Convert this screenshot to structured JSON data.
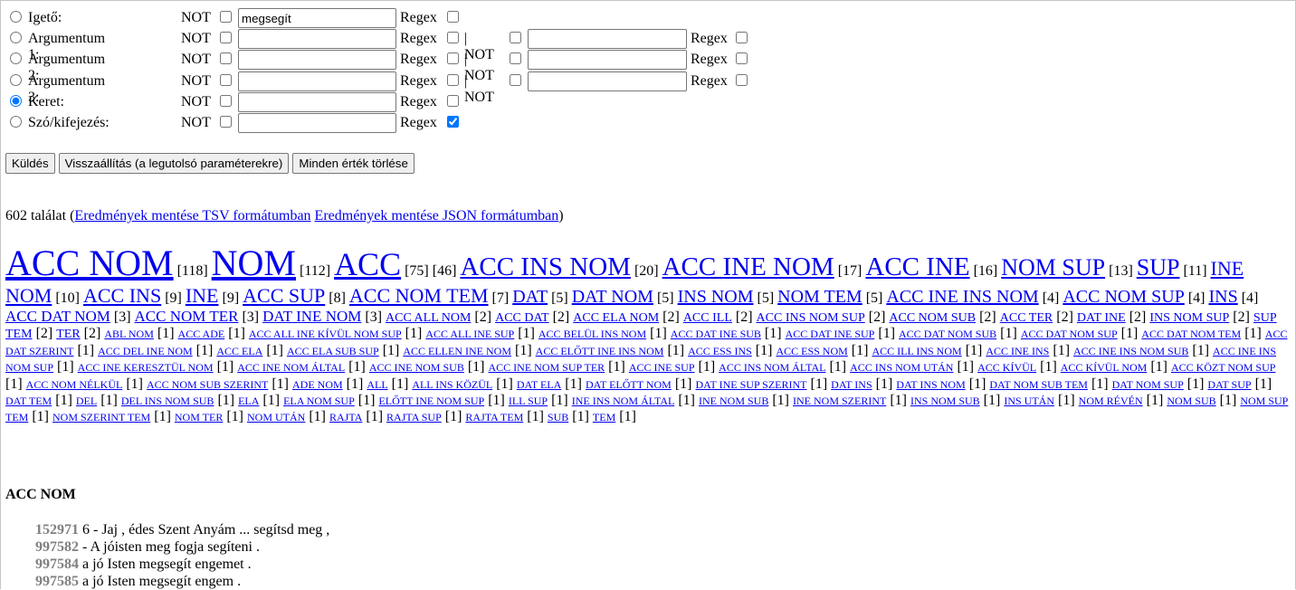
{
  "form": {
    "rows": [
      {
        "label": "Igető:",
        "not": "NOT",
        "regex": "Regex",
        "value": "megsegít",
        "checked": false,
        "regex_checked": false,
        "has_second": false
      },
      {
        "label": "Argumentum 1:",
        "not": "NOT",
        "regex": "Regex",
        "value": "",
        "checked": false,
        "regex_checked": false,
        "has_second": true,
        "sep": "| NOT",
        "regex2": "Regex"
      },
      {
        "label": "Argumentum 2:",
        "not": "NOT",
        "regex": "Regex",
        "value": "",
        "checked": false,
        "regex_checked": false,
        "has_second": true,
        "sep": "| NOT",
        "regex2": "Regex"
      },
      {
        "label": "Argumentum 3:",
        "not": "NOT",
        "regex": "Regex",
        "value": "",
        "checked": false,
        "regex_checked": false,
        "has_second": true,
        "sep": "| NOT",
        "regex2": "Regex"
      },
      {
        "label": "Keret:",
        "not": "NOT",
        "regex": "Regex",
        "value": "",
        "checked": true,
        "regex_checked": false,
        "has_second": false
      },
      {
        "label": "Szó/kifejezés:",
        "not": "NOT",
        "regex": "Regex",
        "value": "",
        "checked": false,
        "regex_checked": true,
        "has_second": false
      }
    ]
  },
  "buttons": {
    "submit": "Küldés",
    "restore": "Visszaállítás (a legutolsó paraméterekre)",
    "clear": "Minden érték törlése"
  },
  "summary": {
    "count_text": "602 találat (",
    "tsv_link": "Eredmények mentése TSV formátumban",
    "json_link": "Eredmények mentése JSON formátumban",
    "close": ")"
  },
  "cloud": [
    {
      "t": "ACC NOM",
      "c": "[118]",
      "s": 1
    },
    {
      "t": "NOM",
      "c": "[112]",
      "s": 1
    },
    {
      "t": "ACC",
      "c": "[75] [46]",
      "s": 2
    },
    {
      "t": "ACC INS NOM",
      "c": "[20]",
      "s": 3
    },
    {
      "t": "ACC INE NOM",
      "c": "[17]",
      "s": 3
    },
    {
      "t": "ACC INE",
      "c": "[16]",
      "s": 3
    },
    {
      "t": "NOM SUP",
      "c": "[13]",
      "s": 4
    },
    {
      "t": "SUP",
      "c": "[11]",
      "s": 4
    },
    {
      "t": "INE NOM",
      "c": "[10]",
      "s": 5
    },
    {
      "t": "ACC INS",
      "c": "[9]",
      "s": 5
    },
    {
      "t": "INE",
      "c": "[9]",
      "s": 5
    },
    {
      "t": "ACC SUP",
      "c": "[8]",
      "s": 5
    },
    {
      "t": "ACC NOM TEM",
      "c": "[7]",
      "s": 5
    },
    {
      "t": "DAT",
      "c": "[5]",
      "s": 6
    },
    {
      "t": "DAT NOM",
      "c": "[5]",
      "s": 6
    },
    {
      "t": "INS NOM",
      "c": "[5]",
      "s": 6
    },
    {
      "t": "NOM TEM",
      "c": "[5]",
      "s": 6
    },
    {
      "t": "ACC INE INS NOM",
      "c": "[4]",
      "s": 6
    },
    {
      "t": "ACC NOM SUP",
      "c": "[4]",
      "s": 6
    },
    {
      "t": "INS",
      "c": "[4]",
      "s": 6
    },
    {
      "t": "ACC DAT NOM",
      "c": "[3]",
      "s": 7
    },
    {
      "t": "ACC NOM TER",
      "c": "[3]",
      "s": 7
    },
    {
      "t": "DAT INE NOM",
      "c": "[3]",
      "s": 7
    },
    {
      "t": "ACC ALL NOM",
      "c": "[2]",
      "s": 8
    },
    {
      "t": "ACC DAT",
      "c": "[2]",
      "s": 8
    },
    {
      "t": "ACC ELA NOM",
      "c": "[2]",
      "s": 8
    },
    {
      "t": "ACC ILL",
      "c": "[2]",
      "s": 8
    },
    {
      "t": "ACC INS NOM SUP",
      "c": "[2]",
      "s": 8
    },
    {
      "t": "ACC NOM SUB",
      "c": "[2]",
      "s": 8
    },
    {
      "t": "ACC TER",
      "c": "[2]",
      "s": 8
    },
    {
      "t": "DAT INE",
      "c": "[2]",
      "s": 8
    },
    {
      "t": "INS NOM SUP",
      "c": "[2]",
      "s": 8
    },
    {
      "t": "SUP TEM",
      "c": "[2]",
      "s": 8
    },
    {
      "t": "TER",
      "c": "[2]",
      "s": 8
    },
    {
      "t": "ABL NOM",
      "c": "[1]",
      "s": 9
    },
    {
      "t": "ACC ADE",
      "c": "[1]",
      "s": 9
    },
    {
      "t": "ACC ALL INE KÍVÜL NOM SUP",
      "c": "[1]",
      "s": 9
    },
    {
      "t": "ACC ALL INE SUP",
      "c": "[1]",
      "s": 9
    },
    {
      "t": "ACC BELÜL INS NOM",
      "c": "[1]",
      "s": 9
    },
    {
      "t": "ACC DAT INE SUB",
      "c": "[1]",
      "s": 9
    },
    {
      "t": "ACC DAT INE SUP",
      "c": "[1]",
      "s": 9
    },
    {
      "t": "ACC DAT NOM SUB",
      "c": "[1]",
      "s": 9
    },
    {
      "t": "ACC DAT NOM SUP",
      "c": "[1]",
      "s": 9
    },
    {
      "t": "ACC DAT NOM TEM",
      "c": "[1]",
      "s": 9
    },
    {
      "t": "ACC DAT SZERINT",
      "c": "[1]",
      "s": 9
    },
    {
      "t": "ACC DEL INE NOM",
      "c": "[1]",
      "s": 9
    },
    {
      "t": "ACC ELA",
      "c": "[1]",
      "s": 9
    },
    {
      "t": "ACC ELA SUB SUP",
      "c": "[1]",
      "s": 9
    },
    {
      "t": "ACC ELLEN INE NOM",
      "c": "[1]",
      "s": 9
    },
    {
      "t": "ACC ELŐTT INE INS NOM",
      "c": "[1]",
      "s": 9
    },
    {
      "t": "ACC ESS INS",
      "c": "[1]",
      "s": 9
    },
    {
      "t": "ACC ESS NOM",
      "c": "[1]",
      "s": 9
    },
    {
      "t": "ACC ILL INS NOM",
      "c": "[1]",
      "s": 9
    },
    {
      "t": "ACC INE INS",
      "c": "[1]",
      "s": 9
    },
    {
      "t": "ACC INE INS NOM SUB",
      "c": "[1]",
      "s": 9
    },
    {
      "t": "ACC INE INS NOM SUP",
      "c": "[1]",
      "s": 9
    },
    {
      "t": "ACC INE KERESZTÜL NOM",
      "c": "[1]",
      "s": 9
    },
    {
      "t": "ACC INE NOM ÁLTAL",
      "c": "[1]",
      "s": 9
    },
    {
      "t": "ACC INE NOM SUB",
      "c": "[1]",
      "s": 9
    },
    {
      "t": "ACC INE NOM SUP TER",
      "c": "[1]",
      "s": 9
    },
    {
      "t": "ACC INE SUP",
      "c": "[1]",
      "s": 9
    },
    {
      "t": "ACC INS NOM ÁLTAL",
      "c": "[1]",
      "s": 9
    },
    {
      "t": "ACC INS NOM UTÁN",
      "c": "[1]",
      "s": 9
    },
    {
      "t": "ACC KÍVÜL",
      "c": "[1]",
      "s": 9
    },
    {
      "t": "ACC KÍVÜL NOM",
      "c": "[1]",
      "s": 9
    },
    {
      "t": "ACC KÖZT NOM SUP",
      "c": "[1]",
      "s": 9
    },
    {
      "t": "ACC NOM NÉLKÜL",
      "c": "[1]",
      "s": 9
    },
    {
      "t": "ACC NOM SUB SZERINT",
      "c": "[1]",
      "s": 9
    },
    {
      "t": "ADE NOM",
      "c": "[1]",
      "s": 9
    },
    {
      "t": "ALL",
      "c": "[1]",
      "s": 9
    },
    {
      "t": "ALL INS KÖZÜL",
      "c": "[1]",
      "s": 9
    },
    {
      "t": "DAT ELA",
      "c": "[1]",
      "s": 9
    },
    {
      "t": "DAT ELŐTT NOM",
      "c": "[1]",
      "s": 9
    },
    {
      "t": "DAT INE SUP SZERINT",
      "c": "[1]",
      "s": 9
    },
    {
      "t": "DAT INS",
      "c": "[1]",
      "s": 9
    },
    {
      "t": "DAT INS NOM",
      "c": "[1]",
      "s": 9
    },
    {
      "t": "DAT NOM SUB TEM",
      "c": "[1]",
      "s": 9
    },
    {
      "t": "DAT NOM SUP",
      "c": "[1]",
      "s": 9
    },
    {
      "t": "DAT SUP",
      "c": "[1]",
      "s": 9
    },
    {
      "t": "DAT TEM",
      "c": "[1]",
      "s": 9
    },
    {
      "t": "DEL",
      "c": "[1]",
      "s": 9
    },
    {
      "t": "DEL INS NOM SUB",
      "c": "[1]",
      "s": 9
    },
    {
      "t": "ELA",
      "c": "[1]",
      "s": 9
    },
    {
      "t": "ELA NOM SUP",
      "c": "[1]",
      "s": 9
    },
    {
      "t": "ELŐTT INE NOM SUP",
      "c": "[1]",
      "s": 9
    },
    {
      "t": "ILL SUP",
      "c": "[1]",
      "s": 9
    },
    {
      "t": "INE INS NOM ÁLTAL",
      "c": "[1]",
      "s": 9
    },
    {
      "t": "INE NOM SUB",
      "c": "[1]",
      "s": 9
    },
    {
      "t": "INE NOM SZERINT",
      "c": "[1]",
      "s": 9
    },
    {
      "t": "INS NOM SUB",
      "c": "[1]",
      "s": 9
    },
    {
      "t": "INS UTÁN",
      "c": "[1]",
      "s": 9
    },
    {
      "t": "NOM RÉVÉN",
      "c": "[1]",
      "s": 9
    },
    {
      "t": "NOM SUB",
      "c": "[1]",
      "s": 9
    },
    {
      "t": "NOM SUP TEM",
      "c": "[1]",
      "s": 9
    },
    {
      "t": "NOM SZERINT TEM",
      "c": "[1]",
      "s": 9
    },
    {
      "t": "NOM TER",
      "c": "[1]",
      "s": 9
    },
    {
      "t": "NOM UTÁN",
      "c": "[1]",
      "s": 9
    },
    {
      "t": "RAJTA",
      "c": "[1]",
      "s": 9
    },
    {
      "t": "RAJTA SUP",
      "c": "[1]",
      "s": 9
    },
    {
      "t": "RAJTA TEM",
      "c": "[1]",
      "s": 9
    },
    {
      "t": "SUB",
      "c": "[1]",
      "s": 9
    },
    {
      "t": "TEM",
      "c": "[1]",
      "s": 9
    }
  ],
  "section_title": "ACC NOM",
  "results": [
    {
      "id": "152971",
      "text": " 6 - Jaj , édes Szent Anyám ... segítsd meg ,"
    },
    {
      "id": "997582",
      "text": " - A jóisten meg fogja segíteni ."
    },
    {
      "id": "997584",
      "text": " a jó Isten megsegít engemet ."
    },
    {
      "id": "997585",
      "text": " a jó Isten megsegít engem ."
    }
  ]
}
